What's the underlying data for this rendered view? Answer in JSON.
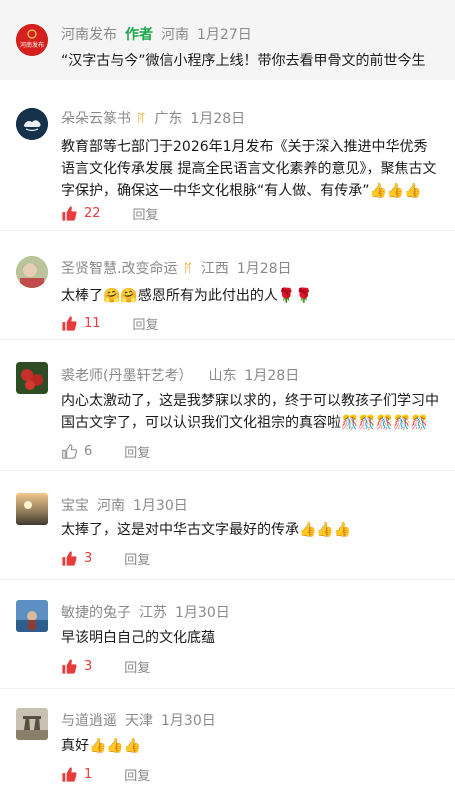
{
  "pinned": {
    "name": "河南发布",
    "tag": "作者",
    "location": "河南",
    "date": "1月27日",
    "content": "“汉字古与今”微信小程序上线！带你去看甲骨文的前世今生",
    "avatar_text": "河南发布"
  },
  "comments": [
    {
      "name": "朵朵云篆书",
      "badge": "ꊮ",
      "location": "广东",
      "date": "1月28日",
      "content": "教育部等七部门于2026年1月发布《关于深入推进中华优秀语言文化传承发展 提高全民语言文化素养的意见》，聚焦古文字保护，确保这一中华文化根脉“有人做、有传承”👍👍👍",
      "likes": "22",
      "liked": true,
      "reply": "回复"
    },
    {
      "name": "圣贤智慧.改变命运",
      "badge": "ꊮ",
      "location": "江西",
      "date": "1月28日",
      "content": "太棒了🤗🤗感恩所有为此付出的人🌹🌹",
      "likes": "11",
      "liked": true,
      "reply": "回复"
    },
    {
      "name": "裘老师(丹墨轩艺考）",
      "location": "山东",
      "date": "1月28日",
      "content": "内心太激动了，这是我梦寐以求的，终于可以教孩子们学习中国古文字了，可以认识我们文化祖宗的真容啦🎊🎊🎊🎊🎊",
      "likes": "6",
      "liked": false,
      "reply": "回复"
    },
    {
      "name": "宝宝",
      "location": "河南",
      "date": "1月30日",
      "content": "太捧了，这是对中华古文字最好的传承👍👍👍",
      "likes": "3",
      "liked": true,
      "reply": "回复"
    },
    {
      "name": "敏捷的兔子",
      "location": "江苏",
      "date": "1月30日",
      "content": "早该明白自己的文化底蕴",
      "likes": "3",
      "liked": true,
      "reply": "回复"
    },
    {
      "name": "与道逍遥",
      "location": "天津",
      "date": "1月30日",
      "content": "真好👍👍👍",
      "likes": "1",
      "liked": true,
      "reply": "回复"
    }
  ],
  "colors": {
    "liked": "#e83b3b",
    "author_tag": "#1ea84a",
    "meta": "#8a8a8a"
  }
}
